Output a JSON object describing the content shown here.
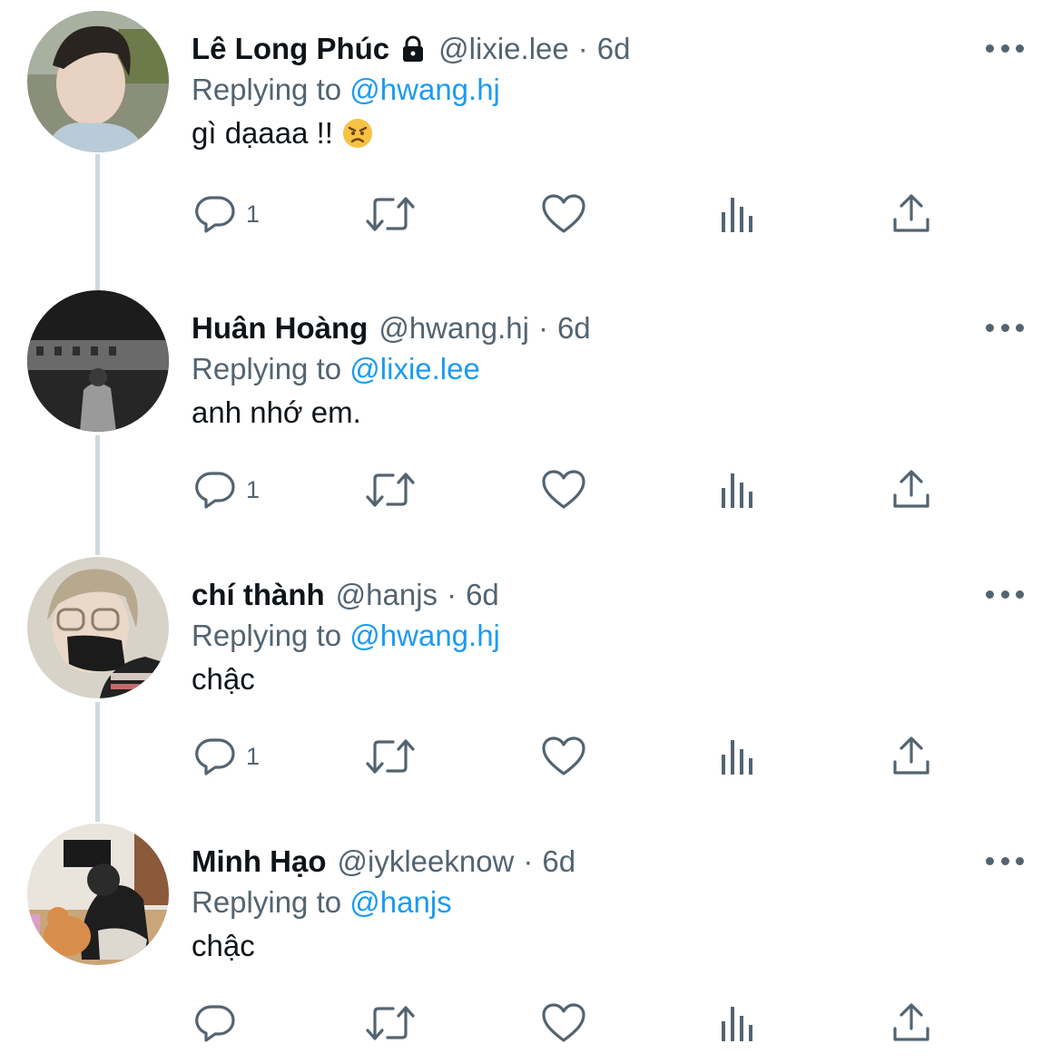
{
  "colors": {
    "text": "#0f1419",
    "secondary": "#536471",
    "link": "#1d9bf0",
    "line": "#cfd9de"
  },
  "tweets": [
    {
      "name": "Lê Long Phúc",
      "locked": true,
      "handle": "@lixie.lee",
      "dot": "·",
      "time": "6d",
      "replying_prefix": "Replying to",
      "replying_to": "@hwang.hj",
      "text": "gì dạaaa !!",
      "emoji": "angry-face-emoji",
      "reply_count": "1"
    },
    {
      "name": "Huân Hoàng",
      "handle": "@hwang.hj",
      "dot": "·",
      "time": "6d",
      "replying_prefix": "Replying to",
      "replying_to": "@lixie.lee",
      "text": "anh nhớ em.",
      "reply_count": "1"
    },
    {
      "name": "chí thành",
      "handle": "@hanjs",
      "dot": "·",
      "time": "6d",
      "replying_prefix": "Replying to",
      "replying_to": "@hwang.hj",
      "text": "chậc",
      "reply_count": "1"
    },
    {
      "name": "Minh Hạo",
      "handle": "@iykleeknow",
      "dot": "·",
      "time": "6d",
      "replying_prefix": "Replying to",
      "replying_to": "@hanjs",
      "text": "chậc",
      "reply_count": ""
    }
  ],
  "icons": [
    "reply-icon",
    "retweet-icon",
    "like-icon",
    "views-icon",
    "share-icon",
    "more-icon",
    "lock-icon"
  ]
}
